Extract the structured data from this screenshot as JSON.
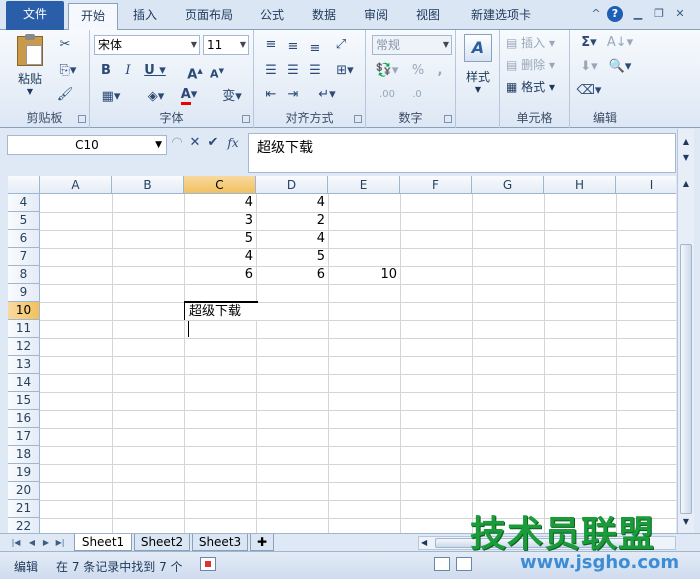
{
  "tabs": [
    {
      "label": "文件",
      "x": 0
    },
    {
      "label": "开始"
    },
    {
      "label": "插入"
    },
    {
      "label": "页面布局"
    },
    {
      "label": "公式"
    },
    {
      "label": "数据"
    },
    {
      "label": "审阅"
    },
    {
      "label": "视图"
    },
    {
      "label": "新建选项卡"
    }
  ],
  "ribbon": {
    "clipboard": {
      "label": "剪贴板",
      "paste": "粘贴"
    },
    "font": {
      "label": "字体",
      "name": "宋体",
      "size": "11"
    },
    "alignment": {
      "label": "对齐方式"
    },
    "number": {
      "label": "数字",
      "format": "常规"
    },
    "styles": {
      "label": "样式"
    },
    "cells": {
      "label": "单元格",
      "insert": "插入",
      "delete": "删除",
      "format": "格式"
    },
    "editing": {
      "label": "编辑"
    }
  },
  "formula_bar": {
    "name_box": "C10",
    "fx": "fx",
    "content": "超级下载"
  },
  "columns": [
    "A",
    "B",
    "C",
    "D",
    "E",
    "F",
    "G",
    "H",
    "I"
  ],
  "selected_column": "C",
  "rows": [
    "4",
    "5",
    "6",
    "7",
    "8",
    "9",
    "10",
    "11",
    "12",
    "13",
    "14",
    "15",
    "16",
    "17",
    "18",
    "19",
    "20",
    "21",
    "22"
  ],
  "selected_row": "10",
  "cells": {
    "C4": "4",
    "D4": "4",
    "C5": "3",
    "D5": "2",
    "C6": "5",
    "D6": "4",
    "C7": "4",
    "D7": "5",
    "C8": "6",
    "D8": "6",
    "E8": "10",
    "C10": "超级下载"
  },
  "sheets": [
    "Sheet1",
    "Sheet2",
    "Sheet3"
  ],
  "active_sheet": "Sheet1",
  "status": {
    "mode": "编辑",
    "message": "在 7 条记录中找到 7 个"
  },
  "watermark": {
    "brand": "技术员联盟",
    "url": "www.jsgho.com"
  },
  "colors": {
    "accent": "#2a5ea8",
    "selection_header": "#f1c15f"
  }
}
